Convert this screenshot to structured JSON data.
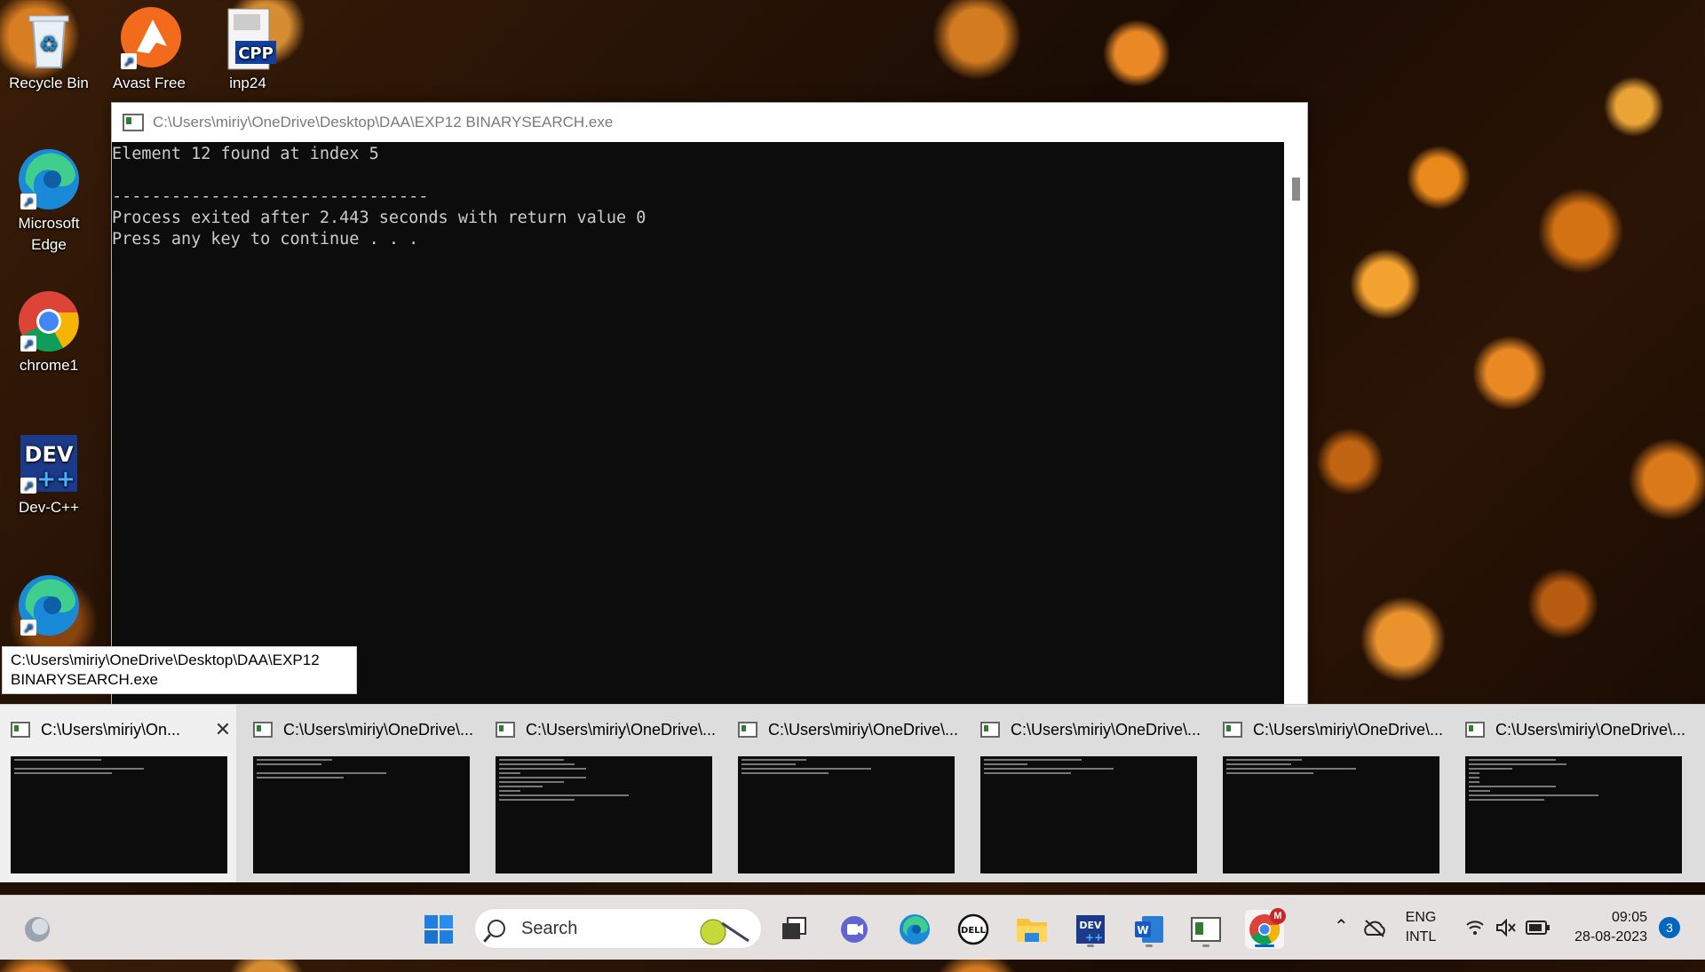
{
  "desktop": {
    "icons": [
      {
        "label": "Recycle Bin"
      },
      {
        "label": "Avast Free"
      },
      {
        "label": "inp24"
      },
      {
        "label": "Microsoft Edge"
      },
      {
        "label": "chrome1"
      },
      {
        "label": "Dev-C++"
      }
    ]
  },
  "console": {
    "title": "C:\\Users\\miriy\\OneDrive\\Desktop\\DAA\\EXP12 BINARYSEARCH.exe",
    "lines": [
      "Element 12 found at index 5",
      "",
      "--------------------------------",
      "Process exited after 2.443 seconds with return value 0",
      "Press any key to continue . . ."
    ]
  },
  "tooltip": {
    "text": "C:\\Users\\miriy\\OneDrive\\Desktop\\DAA\\EXP12 BINARYSEARCH.exe"
  },
  "thumbnails": [
    {
      "title": "C:\\Users\\miriy\\On...",
      "close": "✕"
    },
    {
      "title": "C:\\Users\\miriy\\OneDrive\\..."
    },
    {
      "title": "C:\\Users\\miriy\\OneDrive\\..."
    },
    {
      "title": "C:\\Users\\miriy\\OneDrive\\..."
    },
    {
      "title": "C:\\Users\\miriy\\OneDrive\\..."
    },
    {
      "title": "C:\\Users\\miriy\\OneDrive\\..."
    },
    {
      "title": "C:\\Users\\miriy\\OneDrive\\..."
    }
  ],
  "taskbar": {
    "search_label": "Search",
    "language_top": "ENG",
    "language_bottom": "INTL",
    "time": "09:05",
    "date": "28-08-2023",
    "notification_count": "3",
    "chrome_badge": "M"
  },
  "colors": {
    "accent": "#0067c0",
    "console_bg": "#0c0c0c",
    "console_fg": "#cccccc"
  }
}
